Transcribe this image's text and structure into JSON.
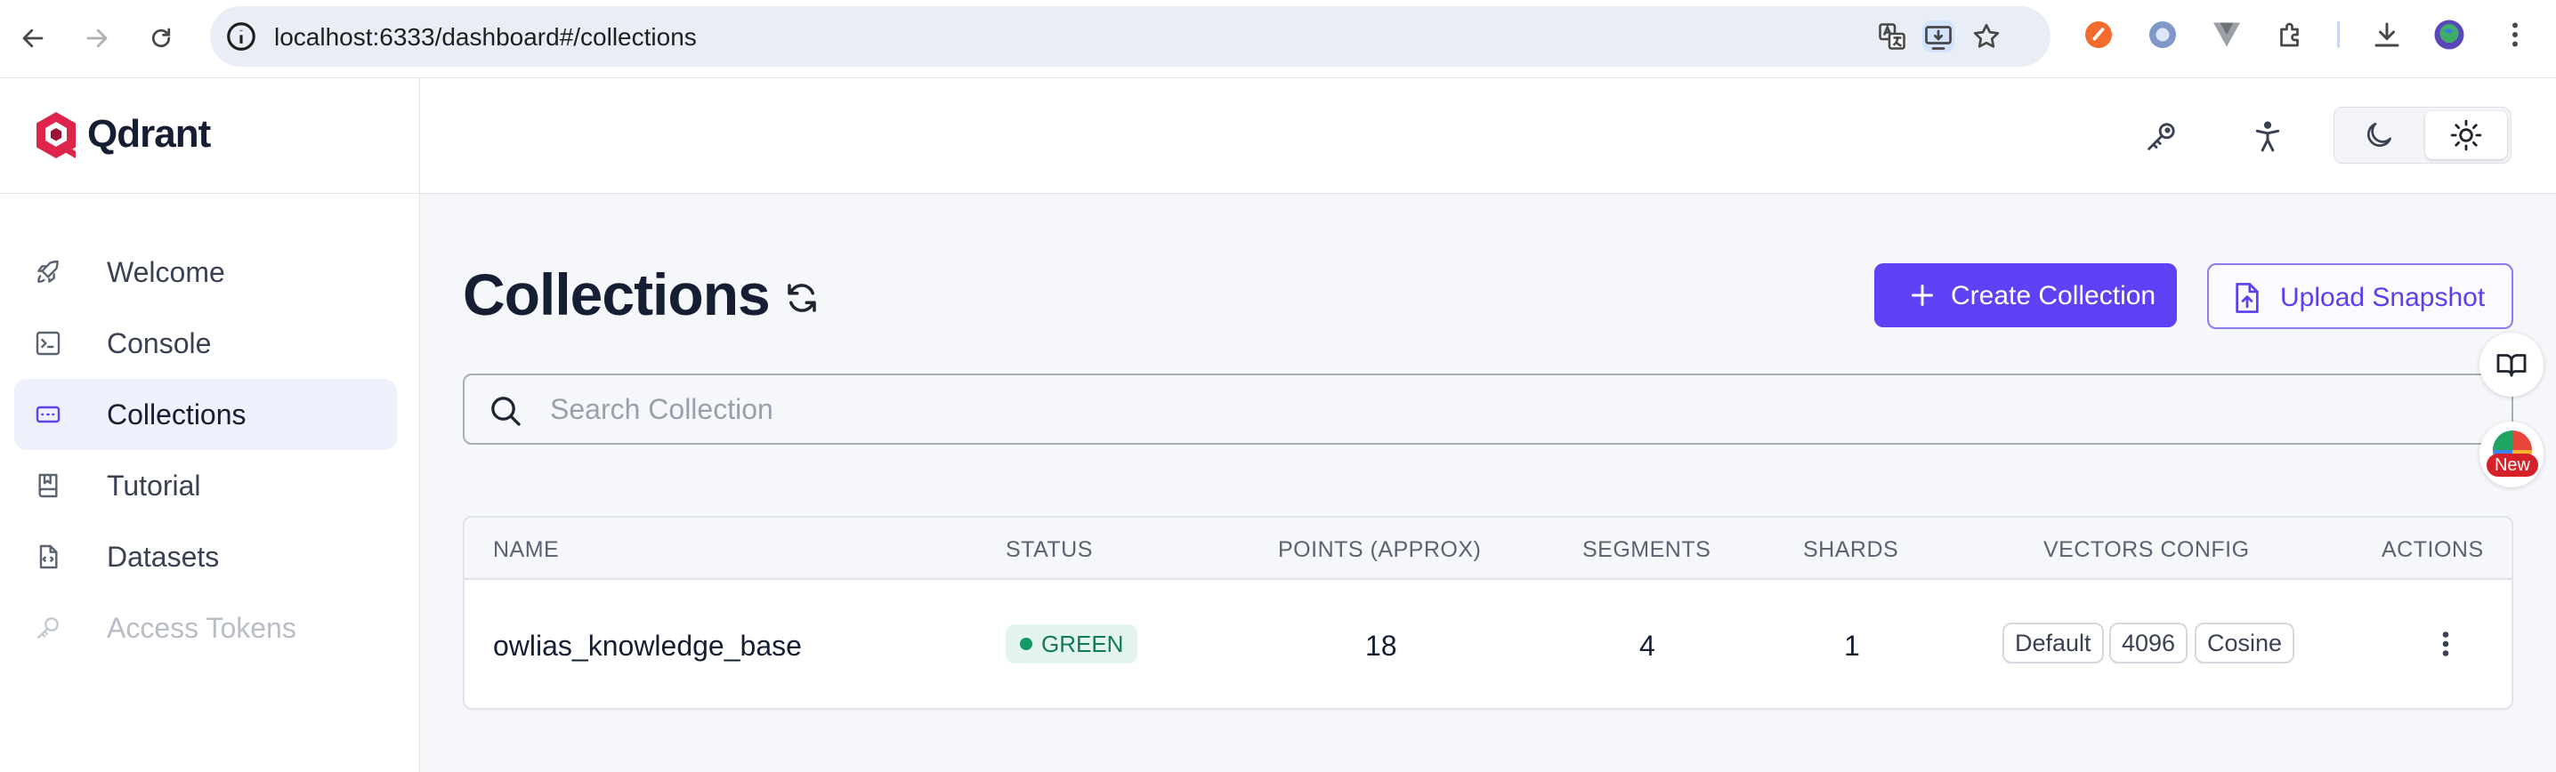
{
  "browser": {
    "url": "localhost:6333/dashboard#/collections"
  },
  "app": {
    "brand": "Qdrant",
    "brand_color": "#dc244c",
    "accent": "#6041f5"
  },
  "sidebar": {
    "items": [
      {
        "label": "Welcome",
        "icon": "rocket-icon"
      },
      {
        "label": "Console",
        "icon": "terminal-icon"
      },
      {
        "label": "Collections",
        "icon": "collections-icon",
        "active": true
      },
      {
        "label": "Tutorial",
        "icon": "book-icon"
      },
      {
        "label": "Datasets",
        "icon": "file-code-icon"
      },
      {
        "label": "Access Tokens",
        "icon": "key-icon",
        "disabled": true
      }
    ]
  },
  "page": {
    "title": "Collections",
    "create_label": "Create Collection",
    "upload_label": "Upload Snapshot",
    "search_placeholder": "Search Collection"
  },
  "floating": {
    "news_badge": "New"
  },
  "table": {
    "headers": [
      "NAME",
      "STATUS",
      "POINTS (APPROX)",
      "SEGMENTS",
      "SHARDS",
      "VECTORS CONFIG",
      "ACTIONS"
    ],
    "rows": [
      {
        "name": "owlias_knowledge_base",
        "status": "GREEN",
        "points": "18",
        "segments": "4",
        "shards": "1",
        "vectors": [
          "Default",
          "4096",
          "Cosine"
        ]
      }
    ]
  }
}
